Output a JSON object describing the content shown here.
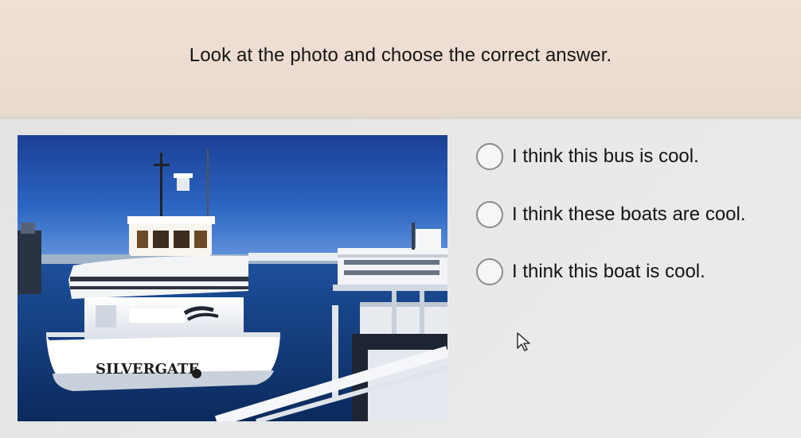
{
  "question": {
    "prompt": "Look at the photo and choose the correct answer."
  },
  "photo": {
    "boat_name_text": "SILVERGATE"
  },
  "options": [
    {
      "label": "I think this bus is cool.",
      "selected": false
    },
    {
      "label": "I think these boats are cool.",
      "selected": false
    },
    {
      "label": "I think this boat is cool.",
      "selected": false
    }
  ],
  "cursor": {
    "icon": "mouse-pointer-icon"
  }
}
